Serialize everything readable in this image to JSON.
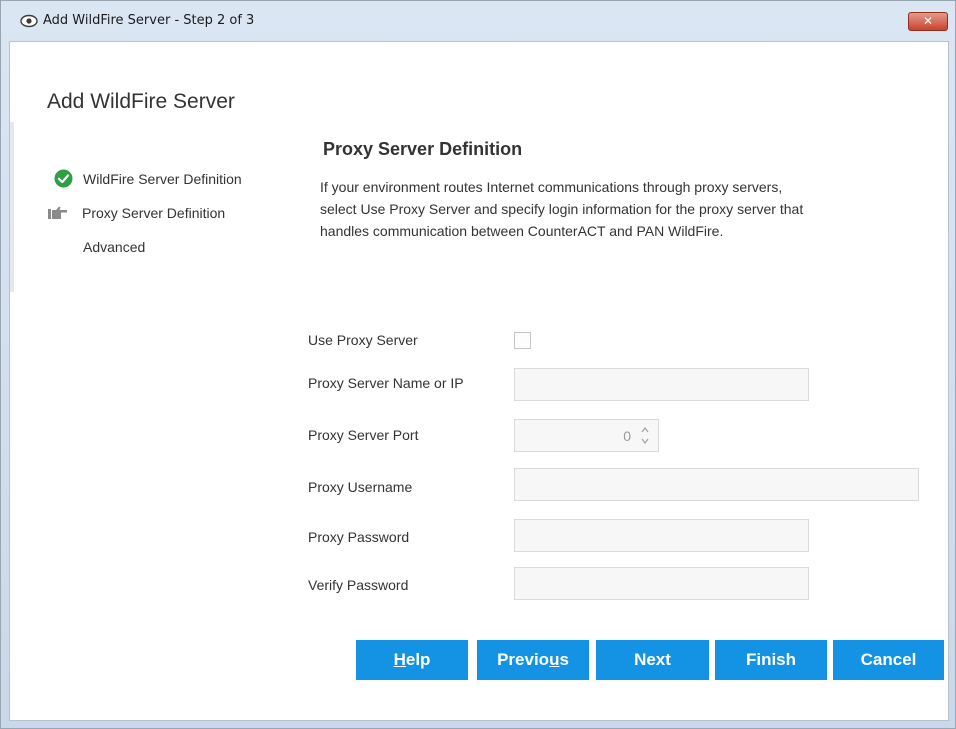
{
  "window": {
    "title": "Add WildFire Server - Step 2 of 3",
    "close_glyph": "✕",
    "title_icon": "eye-icon"
  },
  "page": {
    "title": "Add WildFire Server"
  },
  "steps": [
    {
      "label": "WildFire Server Definition",
      "status": "completed",
      "icon": "check-circle-icon"
    },
    {
      "label": "Proxy Server Definition",
      "status": "current",
      "icon": "thumb-pointer-icon"
    },
    {
      "label": "Advanced",
      "status": "pending"
    }
  ],
  "section": {
    "title": "Proxy Server Definition",
    "description_lines": [
      "If your environment routes Internet communications through proxy servers,",
      "select Use Proxy Server and specify login information for the proxy server that",
      "handles communication between CounterACT and PAN WildFire."
    ]
  },
  "form": {
    "use_proxy_label": "Use Proxy Server",
    "use_proxy_checked": false,
    "server_name_label": "Proxy Server Name or IP",
    "server_name_value": "",
    "port_label": "Proxy Server Port",
    "port_value": "0",
    "username_label": "Proxy Username",
    "username_value": "",
    "password_label": "Proxy Password",
    "password_value": "",
    "verify_label": "Verify Password",
    "verify_value": ""
  },
  "buttons": {
    "help": {
      "pre": "",
      "mnemonic": "H",
      "post": "elp"
    },
    "previous": {
      "pre": "Previo",
      "mnemonic": "u",
      "post": "s"
    },
    "next": "Next",
    "finish": "Finish",
    "cancel": "Cancel"
  },
  "colors": {
    "button_bg": "#1493e5",
    "check_green": "#2ea043",
    "close_red": "#c8452d"
  }
}
